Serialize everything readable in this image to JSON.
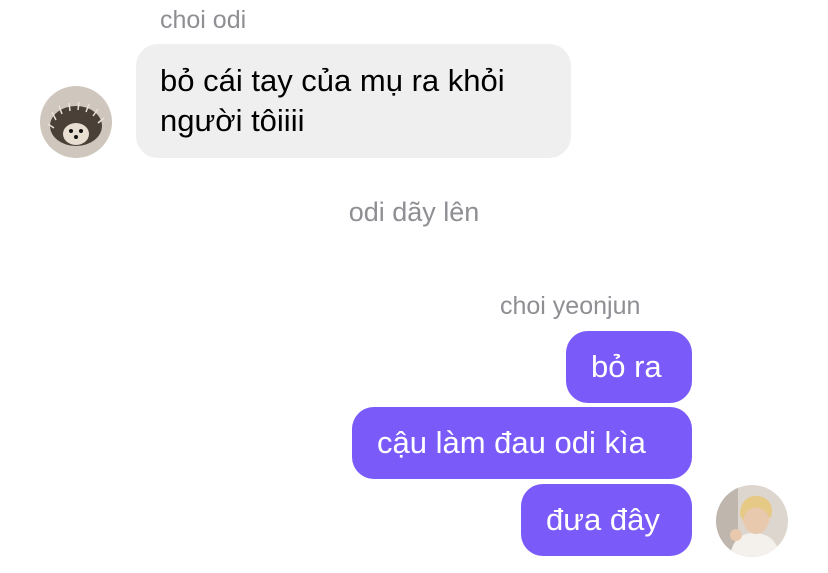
{
  "colors": {
    "incoming_bubble": "#efefef",
    "outgoing_bubble": "#7a5af8",
    "meta_text": "#8e8e93"
  },
  "thread": {
    "incoming": {
      "sender": "choi odi",
      "avatar_icon": "hedgehog-avatar",
      "message_line1": "bỏ cái tay của mụ ra khỏi",
      "message_line2": "người tôiiii"
    },
    "system_note": "odi dãy lên",
    "outgoing": {
      "sender": "choi yeonjun",
      "avatar_icon": "person-avatar",
      "messages": [
        "bỏ ra",
        "cậu làm đau odi kìa",
        "đưa đây"
      ]
    }
  }
}
